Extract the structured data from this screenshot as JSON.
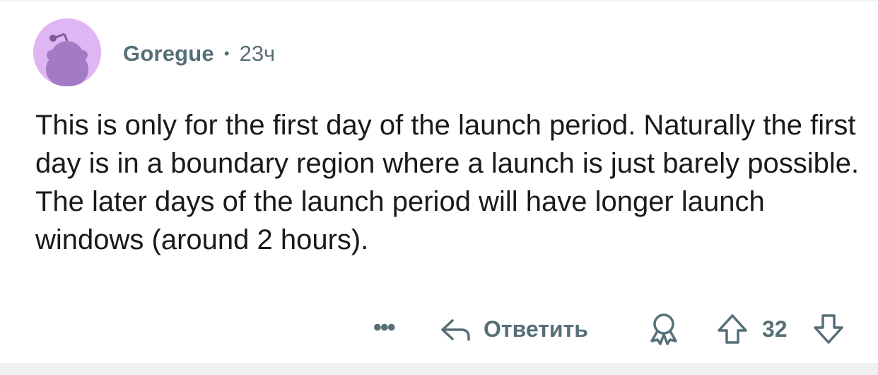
{
  "comment": {
    "author": "Goregue",
    "separator": "•",
    "time": "23ч",
    "body": "This is only for the first day of the launch period. Naturally the first day is in a boundary region where a launch is just barely possible. The later days of the launch period will have longer launch windows (around 2 hours)."
  },
  "actions": {
    "more": "•••",
    "reply_label": "Ответить",
    "score": "32"
  },
  "colors": {
    "avatar_bg": "#e0b5f4",
    "meta_text": "#576f76",
    "body_text": "#1a1a1b"
  },
  "icons": [
    "avatar",
    "more-icon",
    "reply-arrow-icon",
    "award-icon",
    "upvote-arrow-icon",
    "downvote-arrow-icon"
  ]
}
